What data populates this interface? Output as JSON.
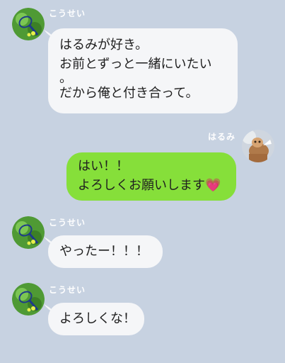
{
  "messages": [
    {
      "sender": "こうせい",
      "side": "left",
      "lines": [
        "はるみが好き。",
        "お前とずっと一緒にいたい",
        "。",
        "だから俺と付き合って。"
      ]
    },
    {
      "sender": "はるみ",
      "side": "right",
      "lines": [
        "はい！！",
        "よろしくお願いします"
      ],
      "emoji": "💗"
    },
    {
      "sender": "こうせい",
      "side": "left",
      "lines": [
        "やったー！！！"
      ]
    },
    {
      "sender": "こうせい",
      "side": "left",
      "lines": [
        "よろしくな！"
      ]
    }
  ],
  "colors": {
    "background": "#c7d2e1",
    "incoming_bubble": "#f5f6f8",
    "outgoing_bubble": "#86df3a",
    "name_text": "#ffffff"
  },
  "icons": {
    "sender_avatar": "tennis-racket-avatar-icon",
    "receiver_avatar": "photo-avatar-icon"
  }
}
